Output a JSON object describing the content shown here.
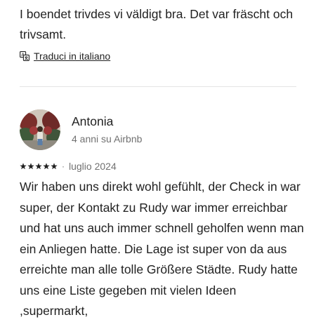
{
  "previous_review": {
    "text": "I boendet trivdes vi väldigt bra. Det var fräscht och trivsamt.",
    "translate_label": "Traduci in italiano"
  },
  "review": {
    "reviewer_name": "Antonia",
    "reviewer_meta": "4 anni su Airbnb",
    "rating": 5,
    "separator": "·",
    "date": "luglio 2024",
    "text": "Wir haben uns direkt wohl gefühlt, der Check in war super, der Kontakt zu Rudy war immer erreichbar und hat uns auch immer schnell geholfen wenn man ein Anliegen hatte. Die Lage ist super von da aus erreichte man alle tolle Größere Städte.  Rudy hatte uns eine Liste gegeben mit vielen Ideen ,supermarkt,"
  }
}
